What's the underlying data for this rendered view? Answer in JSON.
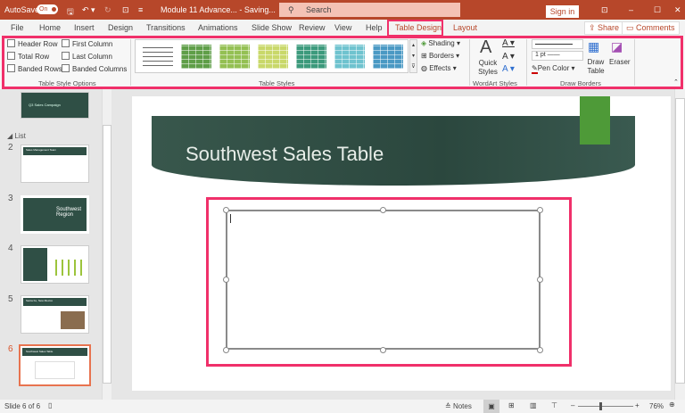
{
  "titlebar": {
    "autosave": "AutoSave",
    "toggle": "On",
    "doc": "Module 11 Advance...  -  Saving...",
    "search": "Search",
    "signin": "Sign in"
  },
  "tabs": [
    "File",
    "Home",
    "Insert",
    "Design",
    "Transitions",
    "Animations",
    "Slide Show",
    "Review",
    "View",
    "Help",
    "Table Design",
    "Layout"
  ],
  "share": "Share",
  "comments": "Comments",
  "ribbon": {
    "options": [
      "Header Row",
      "First Column",
      "Total Row",
      "Last Column",
      "Banded Rows",
      "Banded Columns"
    ],
    "options_label": "Table Style Options",
    "styles_label": "Table Styles",
    "style_colors": [
      "#ffffff",
      "#5f9e48",
      "#94c053",
      "#c9d86a",
      "#3c9a7c",
      "#6fc3cf",
      "#4a99c4"
    ],
    "shading": "Shading",
    "borders": "Borders",
    "effects": "Effects",
    "quick_styles": "Quick Styles",
    "wordart_label": "WordArt Styles",
    "pen_weight": "1 pt",
    "pen_color": "Pen Color",
    "draw_table": "Draw Table",
    "eraser": "Eraser",
    "draw_label": "Draw Borders"
  },
  "slides": {
    "section": "List",
    "items": [
      {
        "n": "2"
      },
      {
        "n": "3"
      },
      {
        "n": "4"
      },
      {
        "n": "5"
      },
      {
        "n": "6"
      }
    ],
    "first_title": "Q3 Sales Campaign",
    "s3": "Southwest Region",
    "s5": "Santa Fe, New Mexico",
    "s6": "Southwest Sales Table",
    "s2": "Sales Management Team"
  },
  "slide": {
    "title": "Southwest Sales Table"
  },
  "status": {
    "slide": "Slide 6 of 6",
    "notes": "Notes",
    "zoom": "76%"
  }
}
